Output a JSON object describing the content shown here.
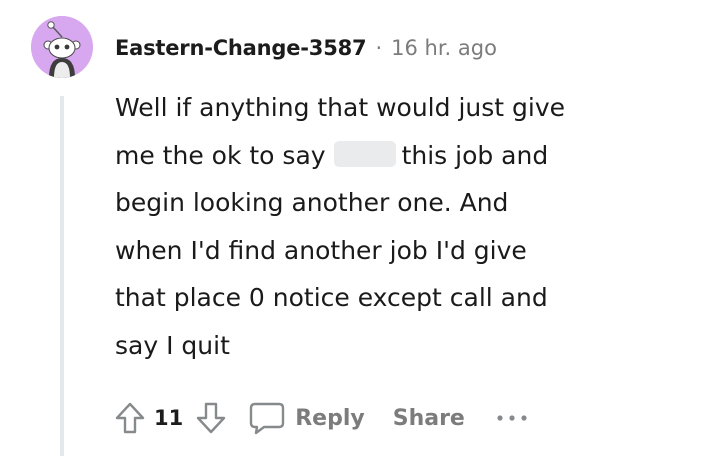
{
  "comment": {
    "username": "Eastern-Change-3587",
    "separator": "·",
    "timestamp": "16 hr. ago",
    "body_lines": [
      [
        "Well if anything that would just give"
      ],
      [
        "me the ok to say",
        "this job and"
      ],
      [
        "begin looking another one. And"
      ],
      [
        "when I'd find another job I'd give"
      ],
      [
        "that place 0 notice except call and"
      ],
      [
        "say I quit"
      ]
    ],
    "has_redaction": true
  },
  "actions": {
    "upvote_icon": "upvote-arrow-icon",
    "vote_count": "11",
    "downvote_icon": "downvote-arrow-icon",
    "reply_icon": "speech-bubble-icon",
    "reply_label": "Reply",
    "share_label": "Share",
    "more_icon": "ellipsis-icon"
  },
  "colors": {
    "avatar_bg": "#d7a8f0",
    "thread_line": "#e5e8ea",
    "meta_text": "#7c7c7c",
    "body_text": "#1a1a1b"
  }
}
